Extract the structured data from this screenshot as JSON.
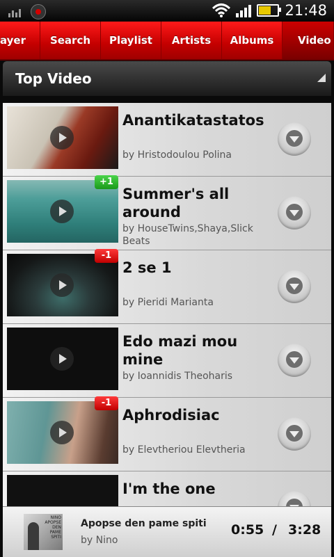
{
  "status": {
    "time": "21:48"
  },
  "tabs": [
    {
      "label": "Player",
      "active": false
    },
    {
      "label": "Search",
      "active": false
    },
    {
      "label": "Playlist",
      "active": false
    },
    {
      "label": "Artists",
      "active": false
    },
    {
      "label": "Albums",
      "active": false
    },
    {
      "label": "Video",
      "active": true
    }
  ],
  "header": {
    "title": "Top Video"
  },
  "items": [
    {
      "title": "Anantikatastatos",
      "artist": "by Hristodoulou Polina",
      "badge": "",
      "badge_type": "",
      "thumb_color": "#8a2a1a"
    },
    {
      "title": "Summer's all around",
      "artist": "by HouseTwins,Shaya,Slick Beats",
      "badge": "+1",
      "badge_type": "up",
      "thumb_color": "#3e8f8a"
    },
    {
      "title": "2 se 1",
      "artist": "by Pieridi Marianta",
      "badge": "-1",
      "badge_type": "down",
      "thumb_color": "#2f3a3a"
    },
    {
      "title": "Edo mazi mou mine",
      "artist": "by Ioannidis Theoharis",
      "badge": "",
      "badge_type": "",
      "thumb_color": "#0e0e0e"
    },
    {
      "title": "Aphrodisiac",
      "artist": "by Elevtheriou Elevtheria",
      "badge": "-1",
      "badge_type": "down",
      "thumb_color": "#5a8c8c"
    },
    {
      "title": "I'm the one",
      "artist": "",
      "badge": "",
      "badge_type": "",
      "thumb_color": "#111111"
    }
  ],
  "now_playing": {
    "title": "Apopse den pame spiti",
    "artist": "by Nino",
    "elapsed": "0:55",
    "separator": "/",
    "duration": "3:28",
    "cover_text": "NINO APOPSE DEN PAME SPITI"
  }
}
